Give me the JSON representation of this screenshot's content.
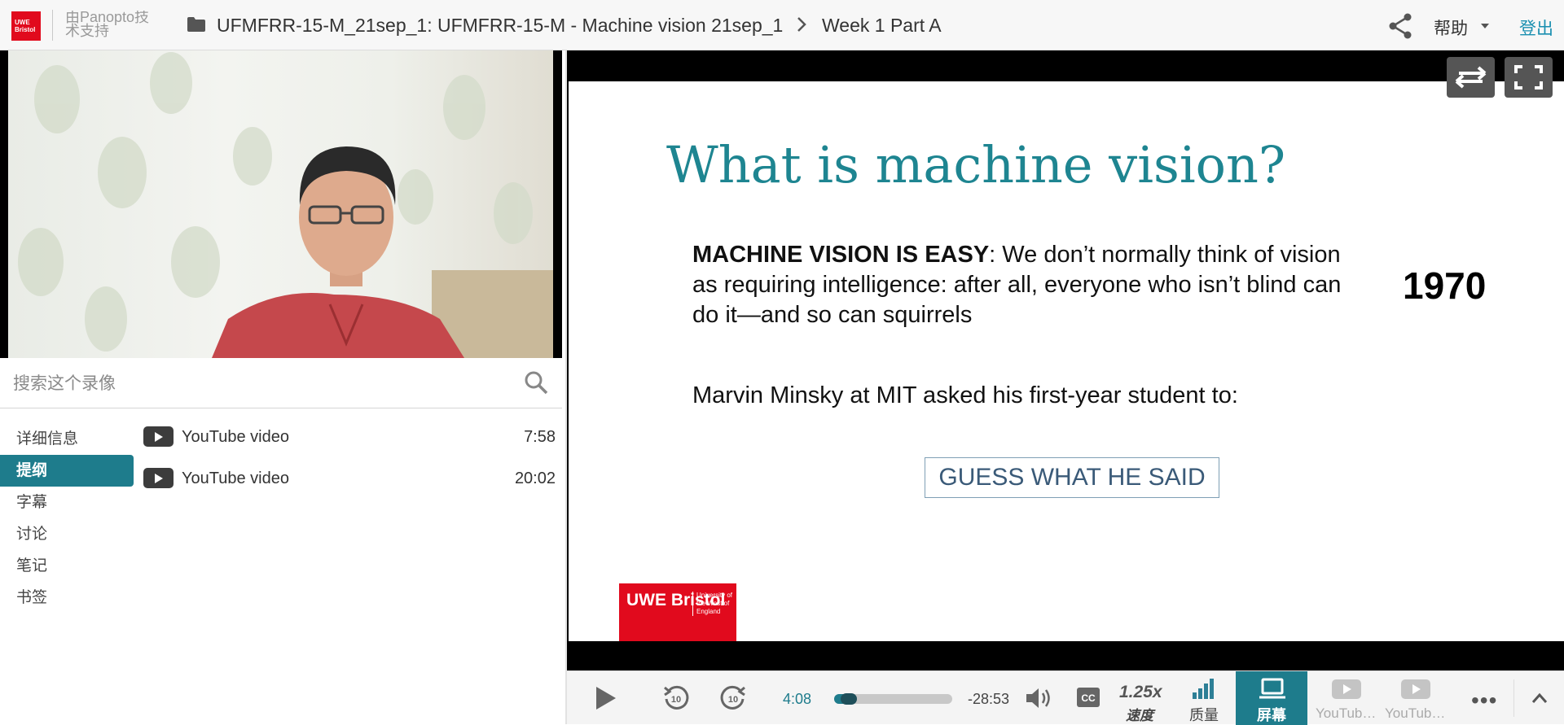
{
  "header": {
    "logo_text": "UWE Bristol",
    "support_text": "由Panopto技术支持",
    "breadcrumb_folder": "UFMFRR-15-M_21sep_1: UFMFRR-15-M - Machine vision 21sep_1",
    "breadcrumb_session": "Week 1 Part A",
    "help_label": "帮助",
    "logout_label": "登出"
  },
  "search": {
    "placeholder": "搜索这个录像"
  },
  "sidebar": {
    "items": [
      {
        "label": "详细信息",
        "active": false
      },
      {
        "label": "提纲",
        "active": true
      },
      {
        "label": "字幕",
        "active": false
      },
      {
        "label": "讨论",
        "active": false
      },
      {
        "label": "笔记",
        "active": false
      },
      {
        "label": "书签",
        "active": false
      }
    ]
  },
  "outline": [
    {
      "title": "YouTube video",
      "time": "7:58"
    },
    {
      "title": "YouTube video",
      "time": "20:02"
    }
  ],
  "slide": {
    "title": "What is machine vision?",
    "para1_bold": "MACHINE VISION IS EASY",
    "para1_rest": ": We don’t normally think of vision as requiring intelligence: after all, everyone who isn’t blind can do it—and so can squirrels",
    "year": "1970",
    "para2": "Marvin Minsky at MIT asked his first-year student to:",
    "guess_button": "GUESS WHAT HE SAID",
    "logo_big": "UWE Bristol",
    "logo_small": "University of the West of England"
  },
  "controls": {
    "elapsed": "4:08",
    "remaining": "-28:53",
    "progress_fraction": 0.125,
    "speed_value": "1.25x",
    "speed_label": "速度",
    "quality_label": "质量",
    "screen_label": "屏幕",
    "youtube_tab_1": "YouTube video",
    "youtube_tab_2": "YouTube video"
  },
  "colors": {
    "accent": "#1e7c8c",
    "brand_red": "#e10a1d",
    "link": "#1a8fb0",
    "slide_title": "#1e8591"
  }
}
